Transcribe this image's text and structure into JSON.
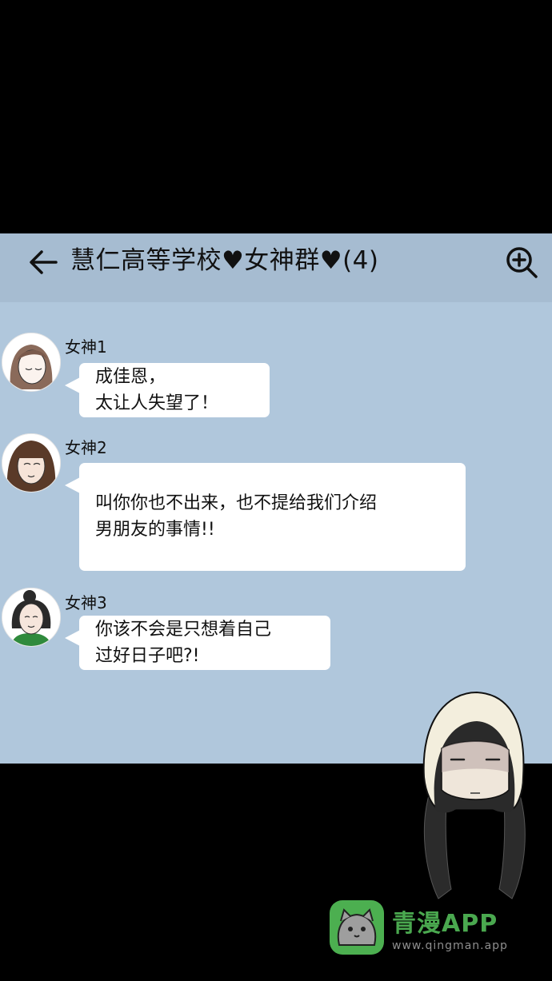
{
  "chat": {
    "back_icon": "arrow-left-icon",
    "title": "慧仁高等学校♥女神群♥(4)",
    "zoom_icon": "zoom-in-icon",
    "messages": [
      {
        "sender": "女神1",
        "lines": [
          "成佳恩，",
          "太让人失望了！"
        ]
      },
      {
        "sender": "女神2",
        "lines": [
          "叫你你也不出来，也不提给我们介绍",
          "男朋友的事情!!"
        ]
      },
      {
        "sender": "女神3",
        "lines": [
          "你该不会是只想着自己",
          "过好日子吧?!"
        ]
      }
    ]
  },
  "watermark": {
    "brand": "青漫APP",
    "url": "www.qingman.app"
  },
  "colors": {
    "background": "#000000",
    "chat_panel": "#b0c7dc",
    "header": "#a6bcd1",
    "bubble": "#ffffff",
    "brand_green": "#4aa84f"
  }
}
